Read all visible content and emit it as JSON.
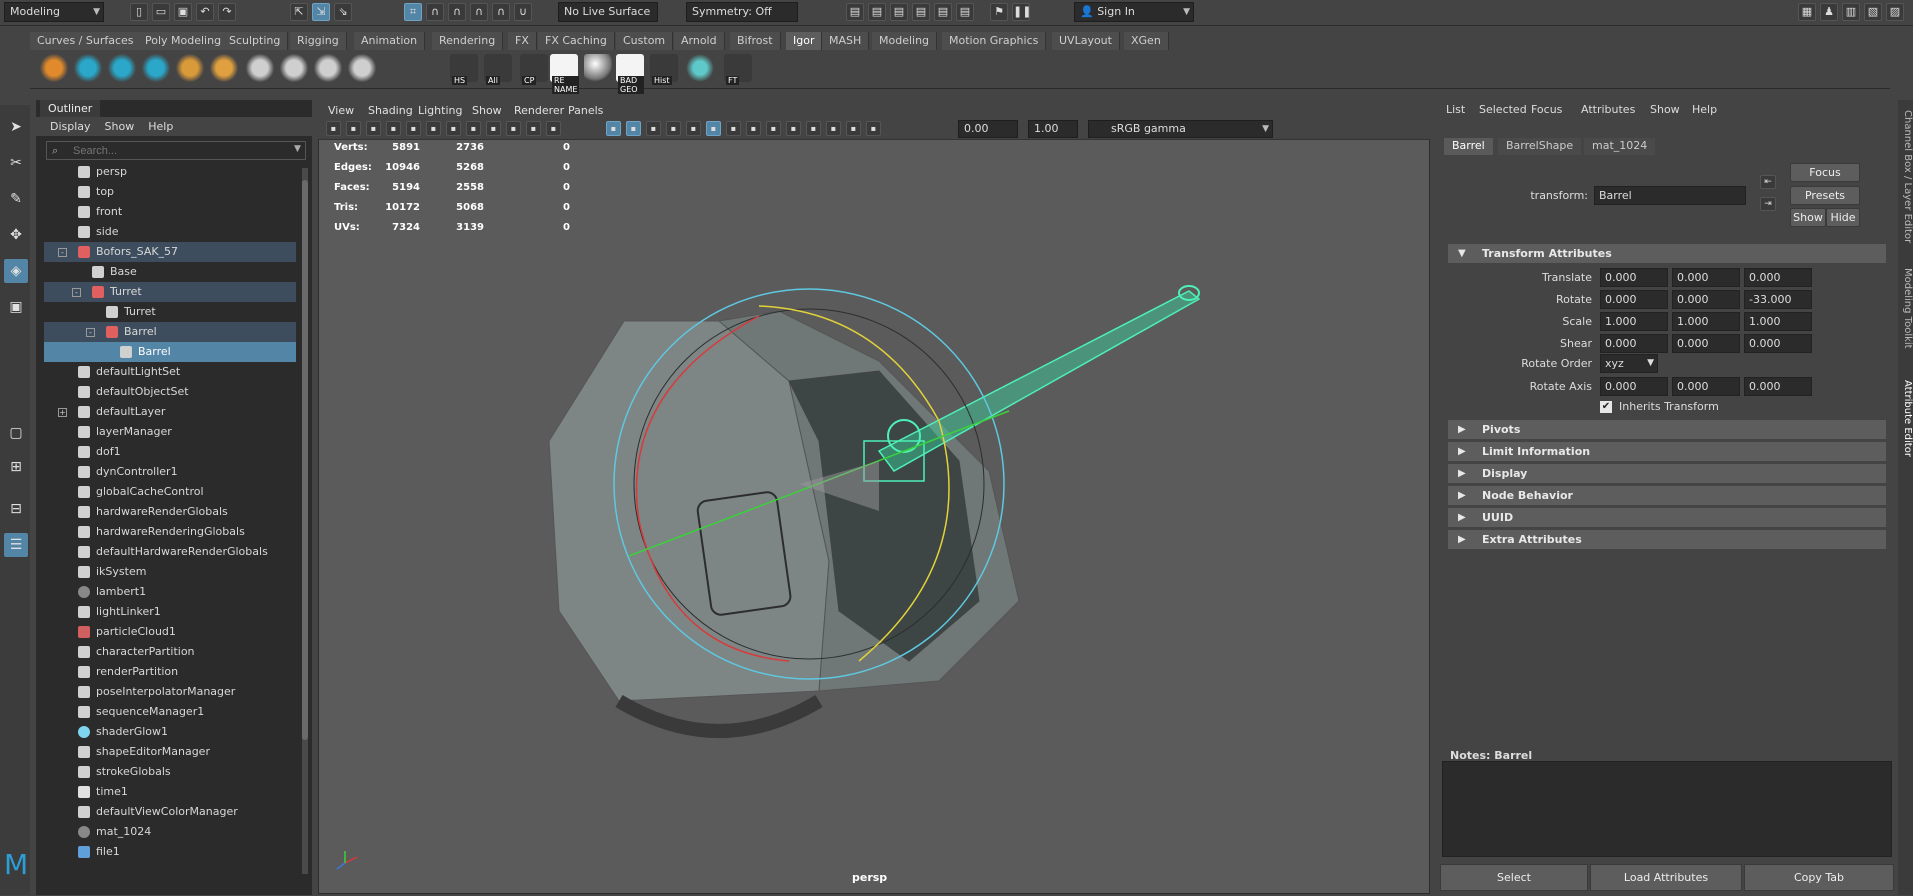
{
  "status_line": {
    "menu_set": "Modeling",
    "live_surface": "No Live Surface",
    "symmetry": "Symmetry: Off",
    "sign_in": "Sign In"
  },
  "shelf_tabs": [
    "Curves / Surfaces",
    "Poly Modeling",
    "Sculpting",
    "Rigging",
    "Animation",
    "Rendering",
    "FX",
    "FX Caching",
    "Custom",
    "Arnold",
    "Bifrost",
    "Igor",
    "MASH",
    "Modeling",
    "Motion Graphics",
    "UVLayout",
    "XGen"
  ],
  "active_shelf_tab": "Igor",
  "shelf_labels": [
    "HS",
    "All",
    "CP",
    "RE NAME",
    "BAD GEO",
    "Hist",
    "FT"
  ],
  "outliner": {
    "tab": "Outliner",
    "menu": [
      "Display",
      "Show",
      "Help"
    ],
    "search_placeholder": "Search...",
    "items": [
      {
        "label": "persp",
        "indent": 0,
        "icon": "camera-icon"
      },
      {
        "label": "top",
        "indent": 0,
        "icon": "camera-icon"
      },
      {
        "label": "front",
        "indent": 0,
        "icon": "camera-icon"
      },
      {
        "label": "side",
        "indent": 0,
        "icon": "camera-icon"
      },
      {
        "label": "Bofors_SAK_57",
        "indent": 0,
        "icon": "transform-icon",
        "expander": "-",
        "state": "parent"
      },
      {
        "label": "Base",
        "indent": 1,
        "icon": "mesh-icon"
      },
      {
        "label": "Turret",
        "indent": 1,
        "icon": "transform-icon",
        "expander": "-",
        "state": "parent"
      },
      {
        "label": "Turret",
        "indent": 2,
        "icon": "mesh-icon"
      },
      {
        "label": "Barrel",
        "indent": 2,
        "icon": "transform-icon",
        "expander": "-",
        "state": "parent"
      },
      {
        "label": "Barrel",
        "indent": 3,
        "icon": "mesh-icon",
        "state": "selected"
      },
      {
        "label": "defaultLightSet",
        "indent": 0,
        "icon": "set-icon"
      },
      {
        "label": "defaultObjectSet",
        "indent": 0,
        "icon": "set-icon"
      },
      {
        "label": "defaultLayer",
        "indent": 0,
        "icon": "layer-icon",
        "expander": "+"
      },
      {
        "label": "layerManager",
        "indent": 0,
        "icon": "node-icon"
      },
      {
        "label": "dof1",
        "indent": 0,
        "icon": "node-icon"
      },
      {
        "label": "dynController1",
        "indent": 0,
        "icon": "node-icon"
      },
      {
        "label": "globalCacheControl",
        "indent": 0,
        "icon": "node-icon"
      },
      {
        "label": "hardwareRenderGlobals",
        "indent": 0,
        "icon": "node-icon"
      },
      {
        "label": "hardwareRenderingGlobals",
        "indent": 0,
        "icon": "node-icon"
      },
      {
        "label": "defaultHardwareRenderGlobals",
        "indent": 0,
        "icon": "node-icon"
      },
      {
        "label": "ikSystem",
        "indent": 0,
        "icon": "node-icon"
      },
      {
        "label": "lambert1",
        "indent": 0,
        "icon": "material-icon"
      },
      {
        "label": "lightLinker1",
        "indent": 0,
        "icon": "node-icon"
      },
      {
        "label": "particleCloud1",
        "indent": 0,
        "icon": "particle-icon"
      },
      {
        "label": "characterPartition",
        "indent": 0,
        "icon": "partition-icon"
      },
      {
        "label": "renderPartition",
        "indent": 0,
        "icon": "partition-icon"
      },
      {
        "label": "poseInterpolatorManager",
        "indent": 0,
        "icon": "node-icon"
      },
      {
        "label": "sequenceManager1",
        "indent": 0,
        "icon": "node-icon"
      },
      {
        "label": "shaderGlow1",
        "indent": 0,
        "icon": "glow-icon"
      },
      {
        "label": "shapeEditorManager",
        "indent": 0,
        "icon": "node-icon"
      },
      {
        "label": "strokeGlobals",
        "indent": 0,
        "icon": "node-icon"
      },
      {
        "label": "time1",
        "indent": 0,
        "icon": "clock-icon"
      },
      {
        "label": "defaultViewColorManager",
        "indent": 0,
        "icon": "node-icon"
      },
      {
        "label": "mat_1024",
        "indent": 0,
        "icon": "material-icon"
      },
      {
        "label": "file1",
        "indent": 0,
        "icon": "file-icon"
      }
    ]
  },
  "viewport": {
    "menu": [
      "View",
      "Shading",
      "Lighting",
      "Show",
      "Renderer",
      "Panels"
    ],
    "exposure": "0.00",
    "gamma": "1.00",
    "color_space": "sRGB gamma",
    "camera": "persp",
    "hud": [
      {
        "label": "Verts:",
        "a": "5891",
        "b": "2736",
        "c": "0"
      },
      {
        "label": "Edges:",
        "a": "10946",
        "b": "5268",
        "c": "0"
      },
      {
        "label": "Faces:",
        "a": "5194",
        "b": "2558",
        "c": "0"
      },
      {
        "label": "Tris:",
        "a": "10172",
        "b": "5068",
        "c": "0"
      },
      {
        "label": "UVs:",
        "a": "7324",
        "b": "3139",
        "c": "0"
      }
    ]
  },
  "attribute_editor": {
    "menu": [
      "List",
      "Selected",
      "Focus",
      "Attributes",
      "Show",
      "Help"
    ],
    "tabs": [
      "Barrel",
      "BarrelShape",
      "mat_1024"
    ],
    "transform_label": "transform:",
    "transform_value": "Barrel",
    "buttons": {
      "focus": "Focus",
      "presets": "Presets",
      "show": "Show",
      "hide": "Hide"
    },
    "section_transform": "Transform Attributes",
    "attrs": [
      {
        "label": "Translate",
        "values": [
          "0.000",
          "0.000",
          "0.000"
        ]
      },
      {
        "label": "Rotate",
        "values": [
          "0.000",
          "0.000",
          "-33.000"
        ]
      },
      {
        "label": "Scale",
        "values": [
          "1.000",
          "1.000",
          "1.000"
        ]
      },
      {
        "label": "Shear",
        "values": [
          "0.000",
          "0.000",
          "0.000"
        ]
      }
    ],
    "rotate_order_label": "Rotate Order",
    "rotate_order": "xyz",
    "rotate_axis_label": "Rotate Axis",
    "rotate_axis": [
      "0.000",
      "0.000",
      "0.000"
    ],
    "inherits_transform": "Inherits Transform",
    "sections": [
      "Pivots",
      "Limit Information",
      "Display",
      "Node Behavior",
      "UUID",
      "Extra Attributes"
    ],
    "notes_label": "Notes:  Barrel",
    "bottom_buttons": [
      "Select",
      "Load Attributes",
      "Copy Tab"
    ]
  },
  "side_tabs": [
    "Channel Box / Layer Editor",
    "Modeling Toolkit",
    "Attribute Editor"
  ]
}
